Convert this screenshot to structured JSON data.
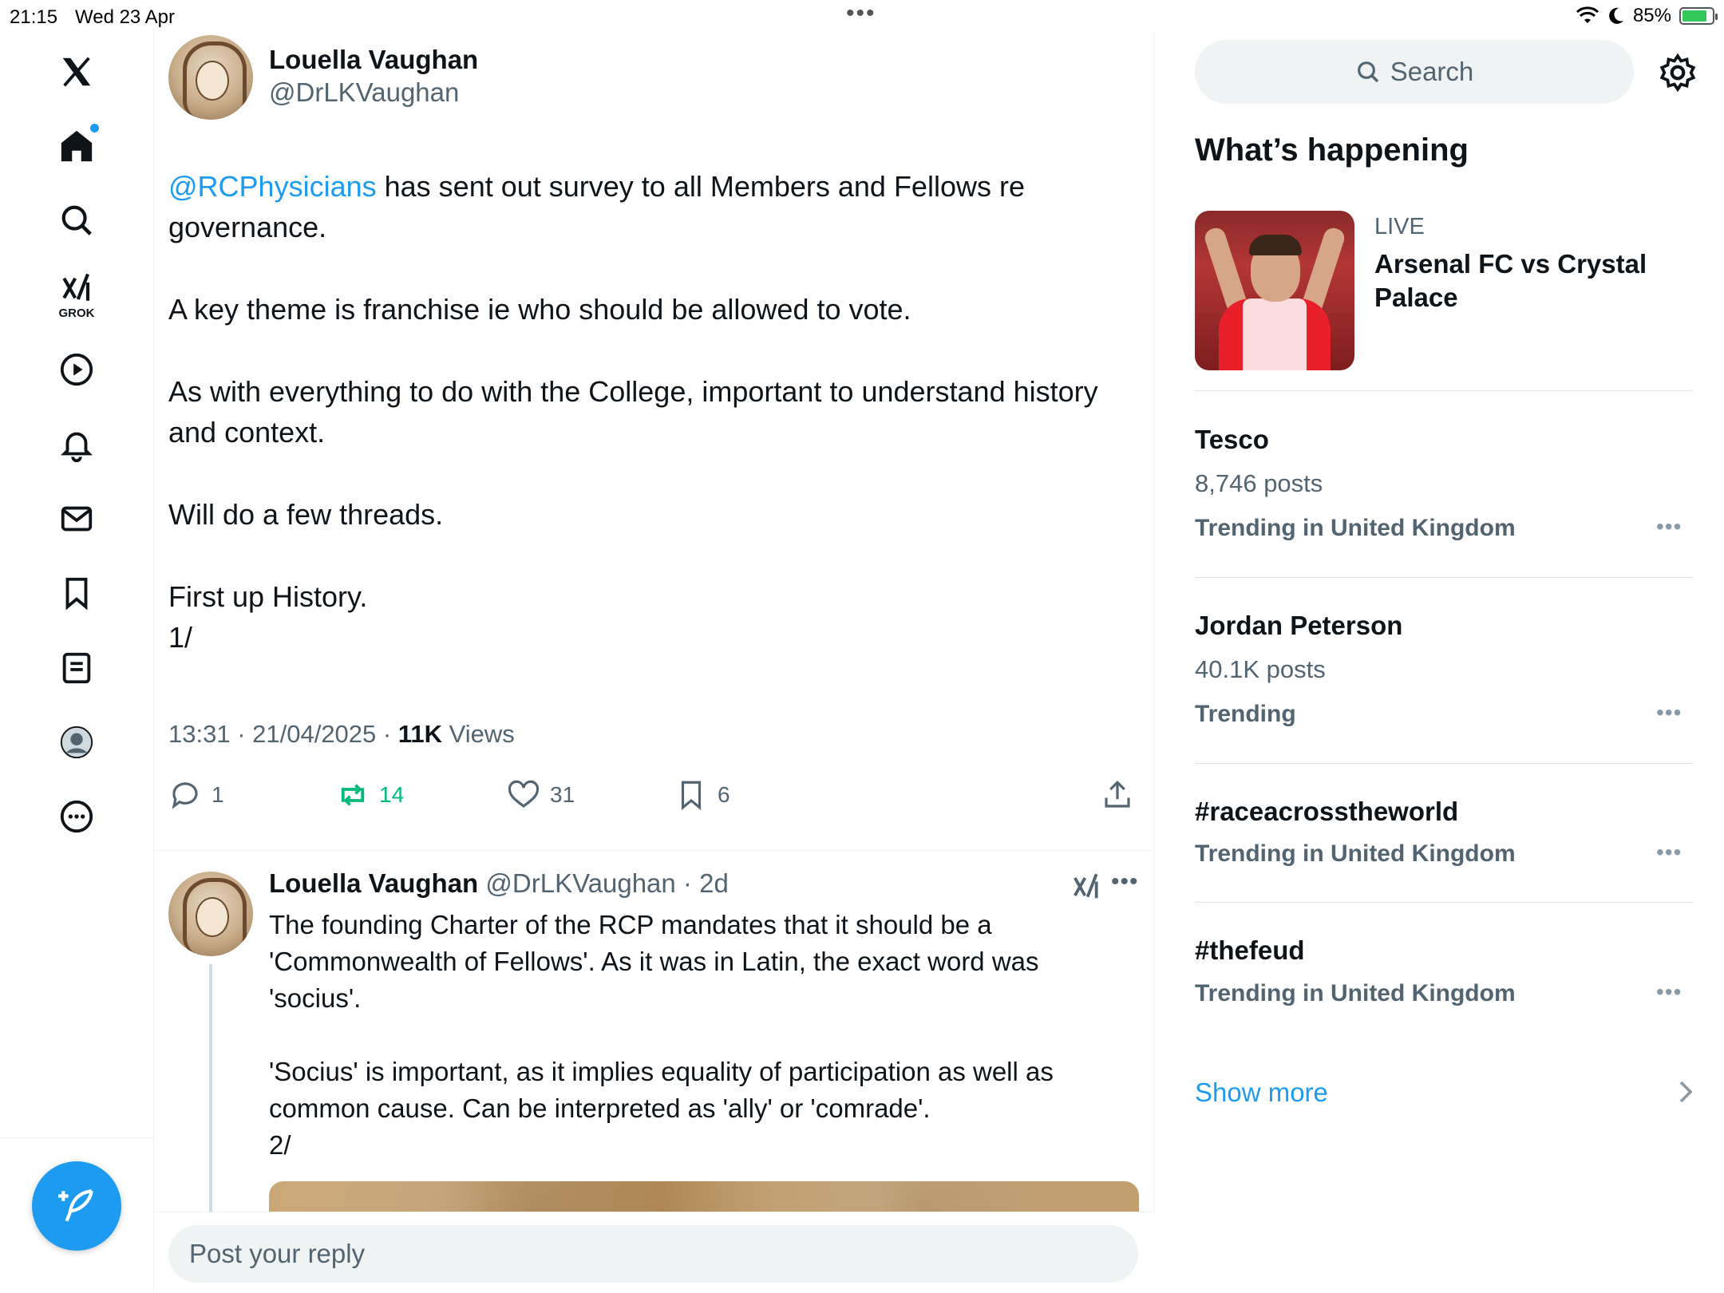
{
  "status_bar": {
    "time": "21:15",
    "date": "Wed 23 Apr",
    "battery": "85%"
  },
  "nav": {
    "grok_label": "GROK",
    "icons": [
      "x-logo-icon",
      "home-icon",
      "search-icon",
      "grok-icon",
      "video-icon",
      "bell-icon",
      "mail-icon",
      "bookmark-icon",
      "list-icon",
      "profile-icon",
      "more-icon"
    ]
  },
  "tweet": {
    "author_name": "Louella Vaughan",
    "author_handle": "@DrLKVaughan",
    "mention": "@RCPhysicians",
    "text_after_mention": " has sent out survey to all Members and Fellows re governance.",
    "para2": "A key theme is franchise ie who should be allowed to vote.",
    "para3": "As with everything to do with the College, important to understand history and context.",
    "para4": "Will do a few threads.",
    "para5_line1": "First up History.",
    "para5_line2": "1/",
    "time": "13:31 · 21/04/2025 · ",
    "views_count": "11K",
    "views_label": " Views",
    "replies": "1",
    "reposts": "14",
    "likes": "31",
    "bookmarks": "6"
  },
  "reply": {
    "author_name": "Louella Vaughan",
    "author_handle": "@DrLKVaughan",
    "age": "2d",
    "para1": "The founding Charter of the RCP mandates that it should be a 'Commonwealth of Fellows'. As it was in Latin, the exact word was 'socius'.",
    "para2_line1": "'Socius' is important, as it implies equality of participation as well as common cause. Can be interpreted as 'ally' or 'comrade'.",
    "para2_line2": "2/"
  },
  "reply_bar": {
    "placeholder": "Post your reply"
  },
  "sidebar": {
    "search_placeholder": "Search",
    "title": "What’s happening",
    "live": {
      "label": "LIVE",
      "title": "Arsenal FC vs Crystal Palace"
    },
    "trends": [
      {
        "name": "Tesco",
        "count": "8,746 posts",
        "context": "Trending in United Kingdom"
      },
      {
        "name": "Jordan Peterson",
        "count": "40.1K posts",
        "context": "Trending"
      },
      {
        "name": "#raceacrosstheworld",
        "count": "",
        "context": "Trending in United Kingdom"
      },
      {
        "name": "#thefeud",
        "count": "",
        "context": "Trending in United Kingdom"
      }
    ],
    "show_more": "Show more"
  },
  "colors": {
    "accent": "#1d9bf0",
    "repost": "#00ba7c",
    "muted": "#536471"
  }
}
